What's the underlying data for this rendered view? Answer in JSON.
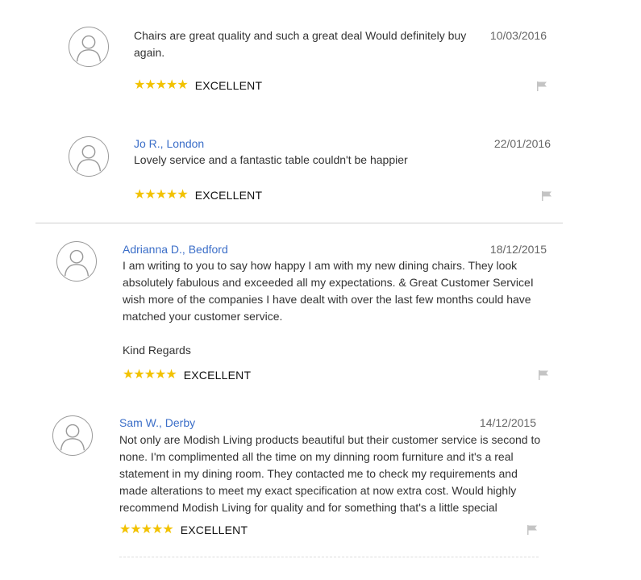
{
  "reviews": [
    {
      "author": "",
      "date": "10/03/2016",
      "text_lines": [
        "Chairs are great quality and such a great deal Would definitely buy",
        "again."
      ],
      "stars": "★★★★★",
      "rating_label": "EXCELLENT"
    },
    {
      "author": "Jo R., London",
      "date": "22/01/2016",
      "text_lines": [
        "Lovely service and a fantastic table couldn't be happier"
      ],
      "stars": "★★★★★",
      "rating_label": "EXCELLENT"
    },
    {
      "author": "Adrianna D., Bedford",
      "date": "18/12/2015",
      "text_lines": [
        "I am writing to you to say how happy I am with my new dining chairs. They look",
        "absolutely fabulous and exceeded all my expectations. & Great Customer ServiceI",
        "wish more of the companies I have dealt with over the last few months could have",
        "matched your customer service.",
        "",
        "Kind Regards"
      ],
      "stars": "★★★★★",
      "rating_label": "EXCELLENT"
    },
    {
      "author": "Sam W., Derby",
      "date": "14/12/2015",
      "text_lines": [
        "Not only are Modish Living products beautiful but their customer service is second to",
        "none. I'm complimented all the time on my dinning room furniture and it's a real",
        "statement in my dining room. They contacted me to check my requirements and",
        "made alterations to meet my exact specification at now extra cost. Would highly",
        "recommend Modish Living for quality and for something that's a little special"
      ],
      "stars": "★★★★★",
      "rating_label": "EXCELLENT"
    }
  ],
  "colors": {
    "author_link": "#3b6ec8",
    "star": "#f2c200",
    "text": "#333333",
    "date": "#666666",
    "flag": "#c4c4c4",
    "avatar_border": "#9a9a9a"
  },
  "icons": {
    "avatar": "user-avatar-icon",
    "flag": "flag-icon",
    "star": "star-icon"
  }
}
